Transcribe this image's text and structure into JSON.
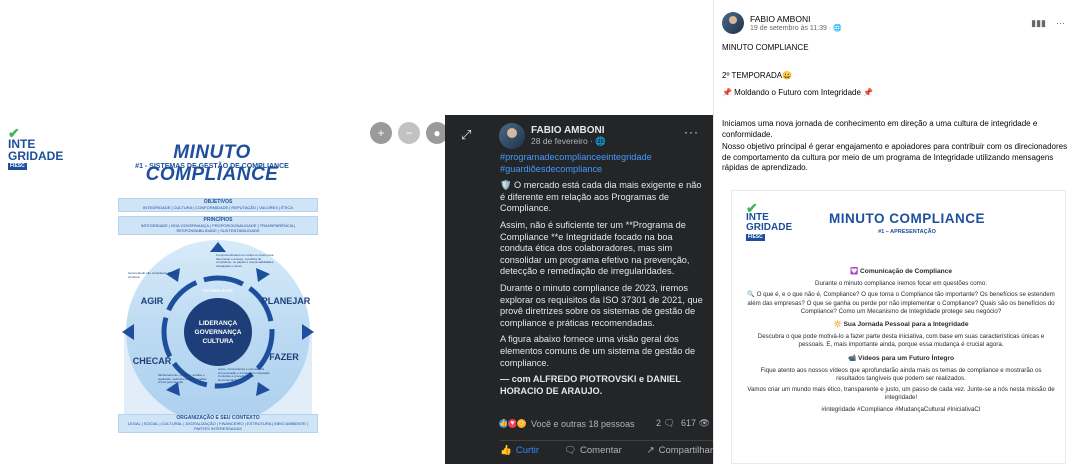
{
  "left": {
    "logo_line1": "INTE",
    "logo_line2": "GRIDADE",
    "logo_tag": "FIESC",
    "title": "MINUTO COMPLIANCE",
    "subtitle": "#1 - SISTEMAS DE GESTÃO DE COMPLIANCE",
    "bar_top_title": "OBJETIVOS",
    "bar_top_text": "INTEGRIDADE | CULTURA | CONFORMIDADE | REPUTAÇÃO | VALORES | ÉTICA",
    "bar_principles_title": "PRINCÍPIOS",
    "bar_principles_text": "INTEGRIDADE | BOA GOVERNANÇA | PROPORCIONALIDADE | TRANSPARÊNCIA | RESPONSABILIDADE | SUSTENTABILIDADE",
    "bar_bottom_title": "ORGANIZAÇÃO E SEU CONTEXTO",
    "bar_bottom_text": "LEGAL | SOCIAL | CULTURAL | DIGITALIZAÇÃO | FINANCEIRO | ESTRUTURA | MEIO AMBIENTE | PARTES INTERESSADAS",
    "quadrants": {
      "tl": "AGIR",
      "tr": "PLANEJAR",
      "bl": "CHECAR",
      "br": "FAZER"
    },
    "center": [
      "LIDERANÇA",
      "GOVERNANÇA",
      "CULTURA"
    ],
    "note_tl": "Gerenciando não compliance Melhoria contínua",
    "note_tr": "Comprometimento em todos os níveis para determinar o escopo, a política de compliance, os papéis e responsabilidades, obrigações e riscos",
    "note_bl": "Monitoramento, medição, análise e avaliação, auditoria interna e análise crítica pela direção",
    "note_br": "Apoio, Competência e consciência Comunicação e treinamento Operação Controles e procedimentos Documentação",
    "ring_top": "ESTABELECER",
    "colors": {
      "brand": "#1d4f9c",
      "green": "#3fb65a",
      "sky": "#cfe4f6"
    }
  },
  "viewer": {
    "zoom_in_icon": "+",
    "zoom_out_icon": "−",
    "tag_icon": "●"
  },
  "mid": {
    "author": "FABIO AMBONI",
    "date": "28 de fevereiro ·",
    "more": "···",
    "hashtags": "#programadecomplianceeintegridade\n#guardiõesdecompliance",
    "p1": "🛡️ O mercado está cada dia mais exigente e não é diferente em relação aos Programas de Compliance.",
    "p2": "Assim, não é suficiente ter um **Programa de Compliance **e Integridade focado na boa conduta ética dos colaboradores, mas sim consolidar um programa efetivo na prevenção, detecção e remediação de irregularidades.",
    "p3": "Durante o minuto compliance de 2023, iremos explorar os requisitos da ISO 37301 de 2021, que provê diretrizes sobre os sistemas de gestão de compliance e práticas recomendadas.",
    "p4": "A figura abaixo fornece uma visão geral dos elementos comuns de um sistema de gestão de compliance.",
    "p5": "— com ALFREDO PIOTROVSKI e DANIEL HORACIO DE ARAUJO.",
    "reactions_text": "Você e outras 18 pessoas",
    "comments_count": "2",
    "views_count": "617",
    "like_label": "Curtir",
    "comment_label": "Comentar",
    "share_label": "Compartilhar"
  },
  "right": {
    "author": "FABIO AMBONI",
    "date": "19 de setembro às 11:39 ·",
    "line_title": "MINUTO COMPLIANCE",
    "line_season": "2º TEMPORADA😀",
    "line_moldando": "📌 Moldando o Futuro com Integridade 📌",
    "para1": "Iniciamos uma nova jornada de conhecimento em direção a uma cultura de integridade e conformidade.",
    "para2": "Nosso objetivo principal é gerar engajamento e apoiadores para contribuir com os direcionadores de comportamento da cultura por meio de um programa de Integridade utilizando mensagens rápidas de aprendizado.",
    "card": {
      "logo_line1": "INTE",
      "logo_line2": "GRIDADE",
      "logo_tag": "FIESC",
      "title": "MINUTO COMPLIANCE",
      "subtitle": "#1 – APRESENTAÇÃO",
      "sec1": "💟 Comunicação de Compliance",
      "t1": "Durante o minuto compliance iremos focar em questões como:",
      "t2": "🔍 O que é, e o que não é, Compliance?  O que torna o Compliance tão importante?  Os benefícios se estendem além das empresas? O que se ganha ou perde por não implementar o Compliance? Quais são os benefícios do Compliance? Como um Mecanismo de Integridade protege seu negócio?",
      "sec2": "🔆 Sua Jornada Pessoal para a Integridade",
      "t3": "Descubra o que pode motivá-lo a fazer parte desta iniciativa, com base em suas características únicas e pessoais. E, mais importante ainda, porque essa mudança é crucial agora.",
      "sec3": "📹 Vídeos para um Futuro Íntegro",
      "t4": "Fique atento aos nossos vídeos que aprofundarão ainda mais os temas de compliance e mostrarão os resultados tangíveis que podem ser realizados.",
      "t5": "Vamos criar um mundo mais ético, transparente e justo, um passo de cada vez. Junte-se a nós nesta missão de integridade!",
      "t6": "#integridade #Compliance #MudançaCultural #IniciativaCI"
    }
  }
}
